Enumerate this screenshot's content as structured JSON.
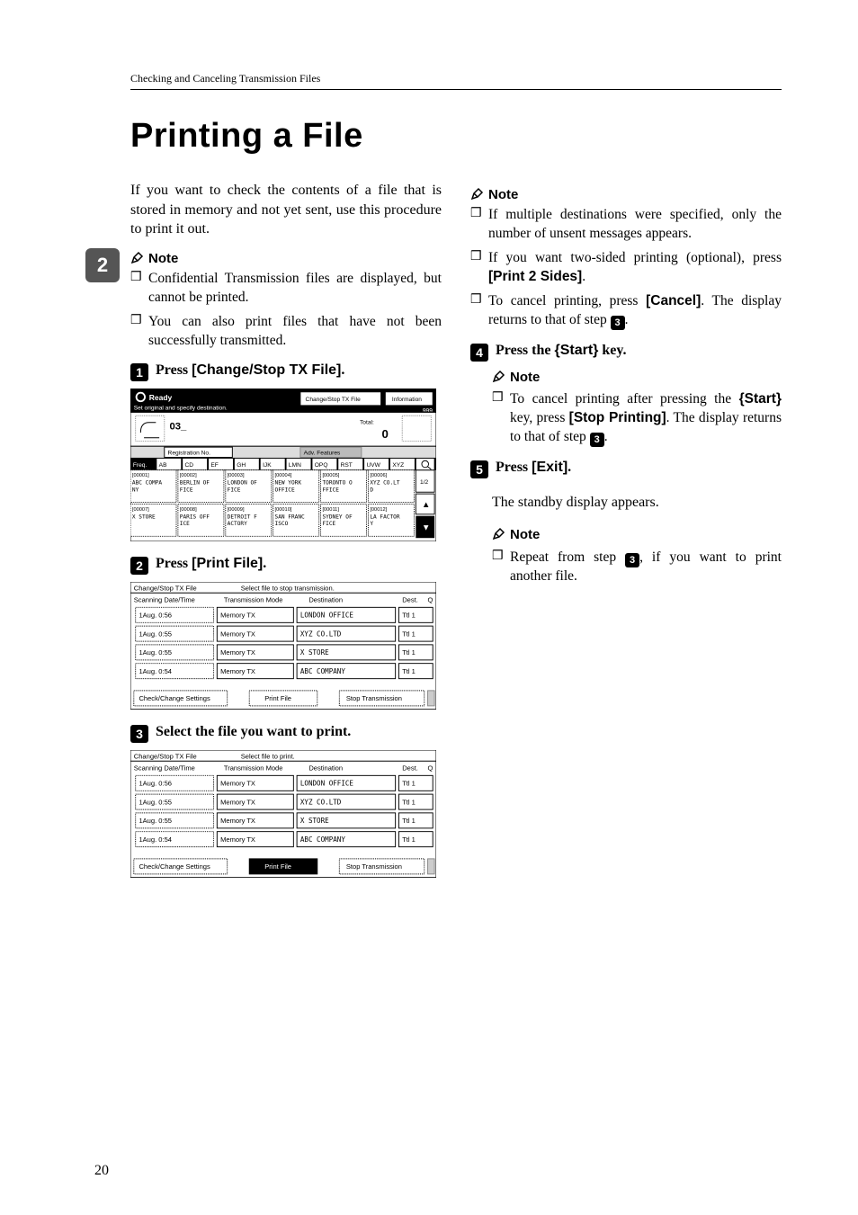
{
  "running_head": "Checking and Canceling Transmission Files",
  "h1": "Printing a File",
  "side_tab": "2",
  "intro": "If you want to check the contents of a file that is stored in memory and not yet sent, use this procedure to print it out.",
  "note_label": "Note",
  "left_notes": [
    "Confidential Transmission files are displayed, but cannot be printed.",
    "You can also print files that have not been successfully transmitted."
  ],
  "steps": {
    "s1": {
      "num": "1",
      "pre": "Press ",
      "btn": "[Change/Stop TX File]",
      "post": "."
    },
    "s2": {
      "num": "2",
      "pre": "Press ",
      "btn": "[Print File]",
      "post": "."
    },
    "s3": {
      "num": "3",
      "text": "Select the file you want to print."
    },
    "s4": {
      "num": "4",
      "pre": "Press the ",
      "key": "Start",
      "post": " key."
    },
    "s5": {
      "num": "5",
      "pre": "Press ",
      "btn": "[Exit]",
      "post": "."
    }
  },
  "right_notes1": [
    "If multiple destinations were specified, only the number of unsent messages appears.",
    {
      "pre": "If you want two-sided printing (optional), press ",
      "btn": "[Print 2 Sides]",
      "post": "."
    },
    {
      "pre": "To cancel printing, press ",
      "btn": "[Cancel]",
      "post": ". The display returns to that of step ",
      "numref": "3",
      "post2": "."
    }
  ],
  "right_notes2": {
    "pre": "To cancel printing after pressing the ",
    "key": "Start",
    "mid": " key, press ",
    "btn": "[Stop Printing]",
    "post": ". The display returns to that of step ",
    "numref": "3",
    "post2": "."
  },
  "standby": "The standby display appears.",
  "right_notes3": {
    "pre": "Repeat from step ",
    "numref": "3",
    "post": ", if you want to print another file."
  },
  "page_number": "20",
  "fig1": {
    "ready": "Ready",
    "subtitle": "Set original and specify destination.",
    "change_btn": "Change/Stop TX File",
    "info_btn": "Information",
    "count": "999",
    "dial03": "03_",
    "total_label": "Total:",
    "total_val": "0",
    "reg_label": "Registration No.",
    "adv_label": "Adv. Features",
    "tabs": [
      "Freq.",
      "AB",
      "CD",
      "EF",
      "GH",
      "IJK",
      "LMN",
      "OPQ",
      "RST",
      "UVW",
      "XYZ"
    ],
    "row1": [
      {
        "code": "[00001]",
        "name": "ABC COMPANY"
      },
      {
        "code": "[00002]",
        "name": "BERLIN OFFICE"
      },
      {
        "code": "[00003]",
        "name": "LONDON OFFICE"
      },
      {
        "code": "[00004]",
        "name": "NEW YORK OFFICE"
      },
      {
        "code": "[00005]",
        "name": "TORONTO OFFICE"
      },
      {
        "code": "[00006]",
        "name": "XYZ CO.LTD"
      }
    ],
    "row2": [
      {
        "code": "[00007]",
        "name": "X STORE"
      },
      {
        "code": "[00008]",
        "name": "PARIS OFFICE"
      },
      {
        "code": "[00009]",
        "name": "DETROIT FACTORY"
      },
      {
        "code": "[00010]",
        "name": "SAN FRANCISCO"
      },
      {
        "code": "[00011]",
        "name": "SYDNEY OFFICE"
      },
      {
        "code": "[00012]",
        "name": "LA FACTORY"
      }
    ],
    "pager": "1/2"
  },
  "fig2": {
    "title": "Change/Stop TX File",
    "subtitle": "Select file to stop transmission.",
    "cols": [
      "Scanning Date/Time",
      "Transmission Mode",
      "Destination",
      "Dest.",
      "Q"
    ],
    "rows": [
      {
        "dt": "1Aug.  0:56",
        "mode": "Memory TX",
        "dest": "LONDON OFFICE",
        "cnt": "Ttl  1"
      },
      {
        "dt": "1Aug.  0:55",
        "mode": "Memory TX",
        "dest": "XYZ CO.LTD",
        "cnt": "Ttl  1"
      },
      {
        "dt": "1Aug.  0:55",
        "mode": "Memory TX",
        "dest": "X STORE",
        "cnt": "Ttl  1"
      },
      {
        "dt": "1Aug.  0:54",
        "mode": "Memory TX",
        "dest": "ABC COMPANY",
        "cnt": "Ttl  1"
      }
    ],
    "btns": [
      "Check/Change Settings",
      "Print File",
      "Stop Transmission"
    ]
  },
  "fig3": {
    "title": "Change/Stop TX File",
    "subtitle": "Select file to print.",
    "cols": [
      "Scanning Date/Time",
      "Transmission Mode",
      "Destination",
      "Dest.",
      "Q"
    ],
    "rows": [
      {
        "dt": "1Aug.  0:56",
        "mode": "Memory TX",
        "dest": "LONDON OFFICE",
        "cnt": "Ttl  1"
      },
      {
        "dt": "1Aug.  0:55",
        "mode": "Memory TX",
        "dest": "XYZ CO.LTD",
        "cnt": "Ttl  1"
      },
      {
        "dt": "1Aug.  0:55",
        "mode": "Memory TX",
        "dest": "X STORE",
        "cnt": "Ttl  1"
      },
      {
        "dt": "1Aug.  0:54",
        "mode": "Memory TX",
        "dest": "ABC COMPANY",
        "cnt": "Ttl  1"
      }
    ],
    "btns": [
      "Check/Change Settings",
      "Print File",
      "Stop Transmission"
    ]
  }
}
